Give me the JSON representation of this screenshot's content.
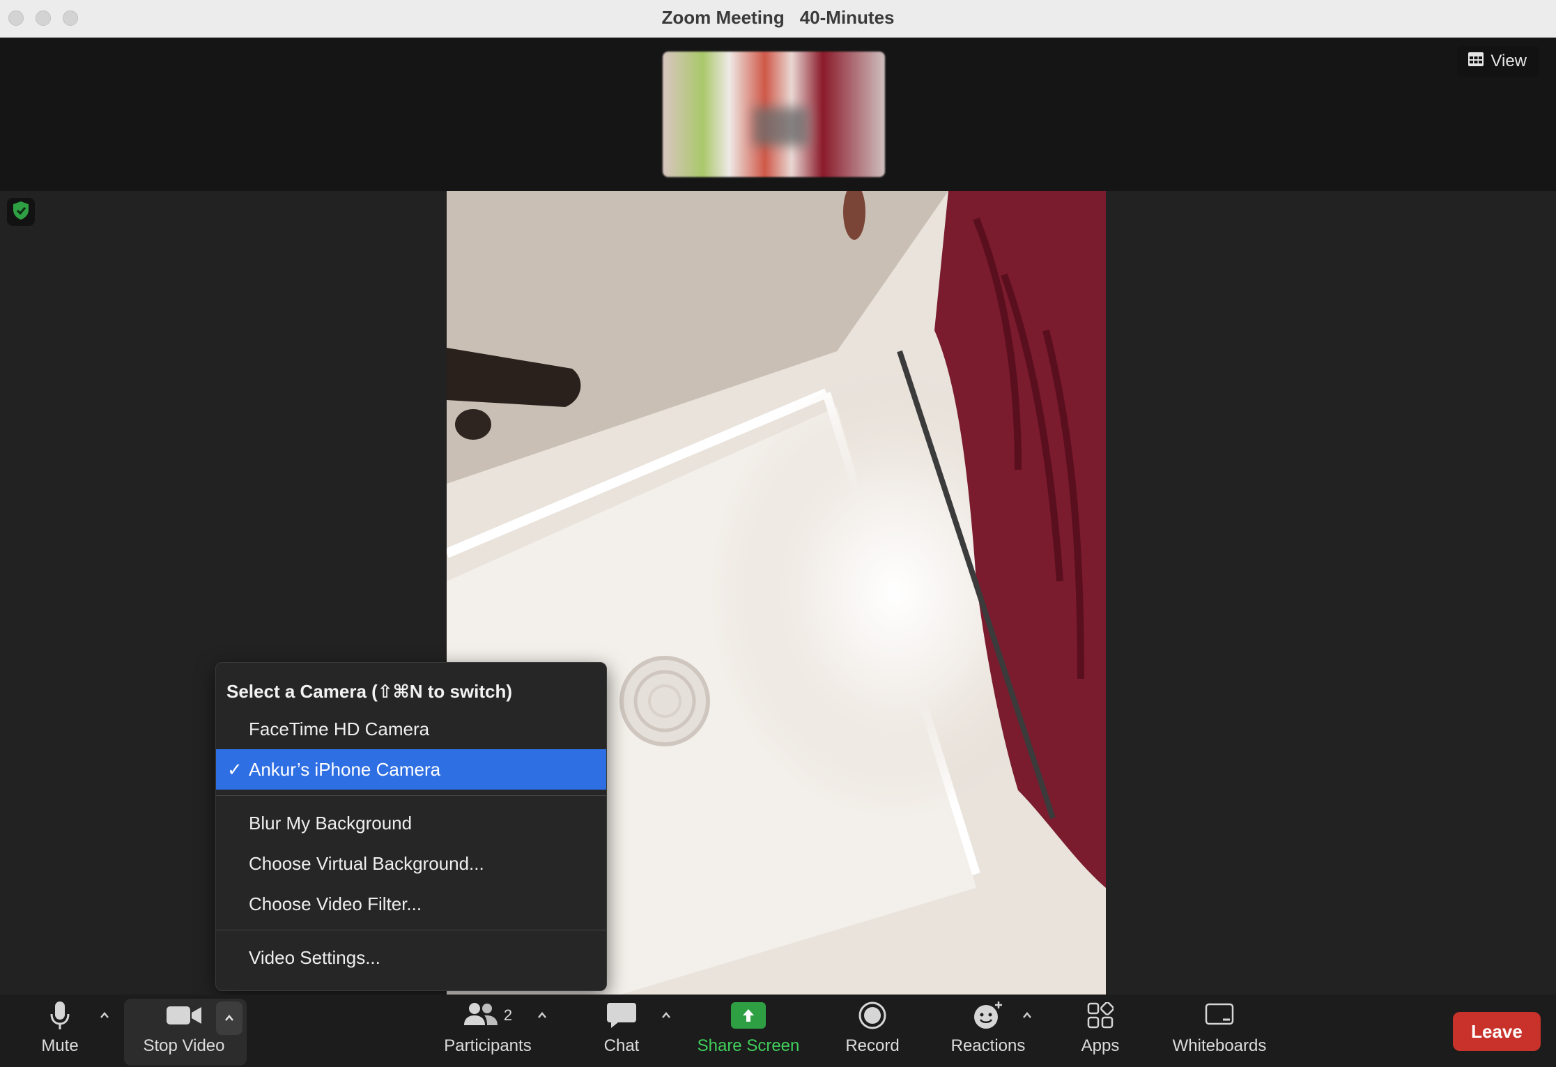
{
  "window": {
    "title": "Zoom Meeting",
    "subtitle": "40-Minutes"
  },
  "top": {
    "view_label": "View",
    "view_icon": "grid-icon"
  },
  "security": {
    "icon": "shield-check-icon",
    "color": "#2ea043"
  },
  "camera_menu": {
    "header": "Select a Camera (⇧⌘N to switch)",
    "cameras": [
      {
        "label": "FaceTime HD Camera",
        "selected": false
      },
      {
        "label": "Ankur’s iPhone Camera",
        "selected": true
      }
    ],
    "options": [
      "Blur My Background",
      "Choose Virtual Background...",
      "Choose Video Filter..."
    ],
    "settings": "Video Settings...",
    "accent": "#2f6fe4"
  },
  "toolbar": {
    "mute": "Mute",
    "stop_video": "Stop Video",
    "participants": "Participants",
    "participants_count": "2",
    "chat": "Chat",
    "share_screen": "Share Screen",
    "share_color": "#2ea043",
    "record": "Record",
    "reactions": "Reactions",
    "apps": "Apps",
    "whiteboards": "Whiteboards",
    "leave": "Leave",
    "leave_color": "#c8322a"
  }
}
